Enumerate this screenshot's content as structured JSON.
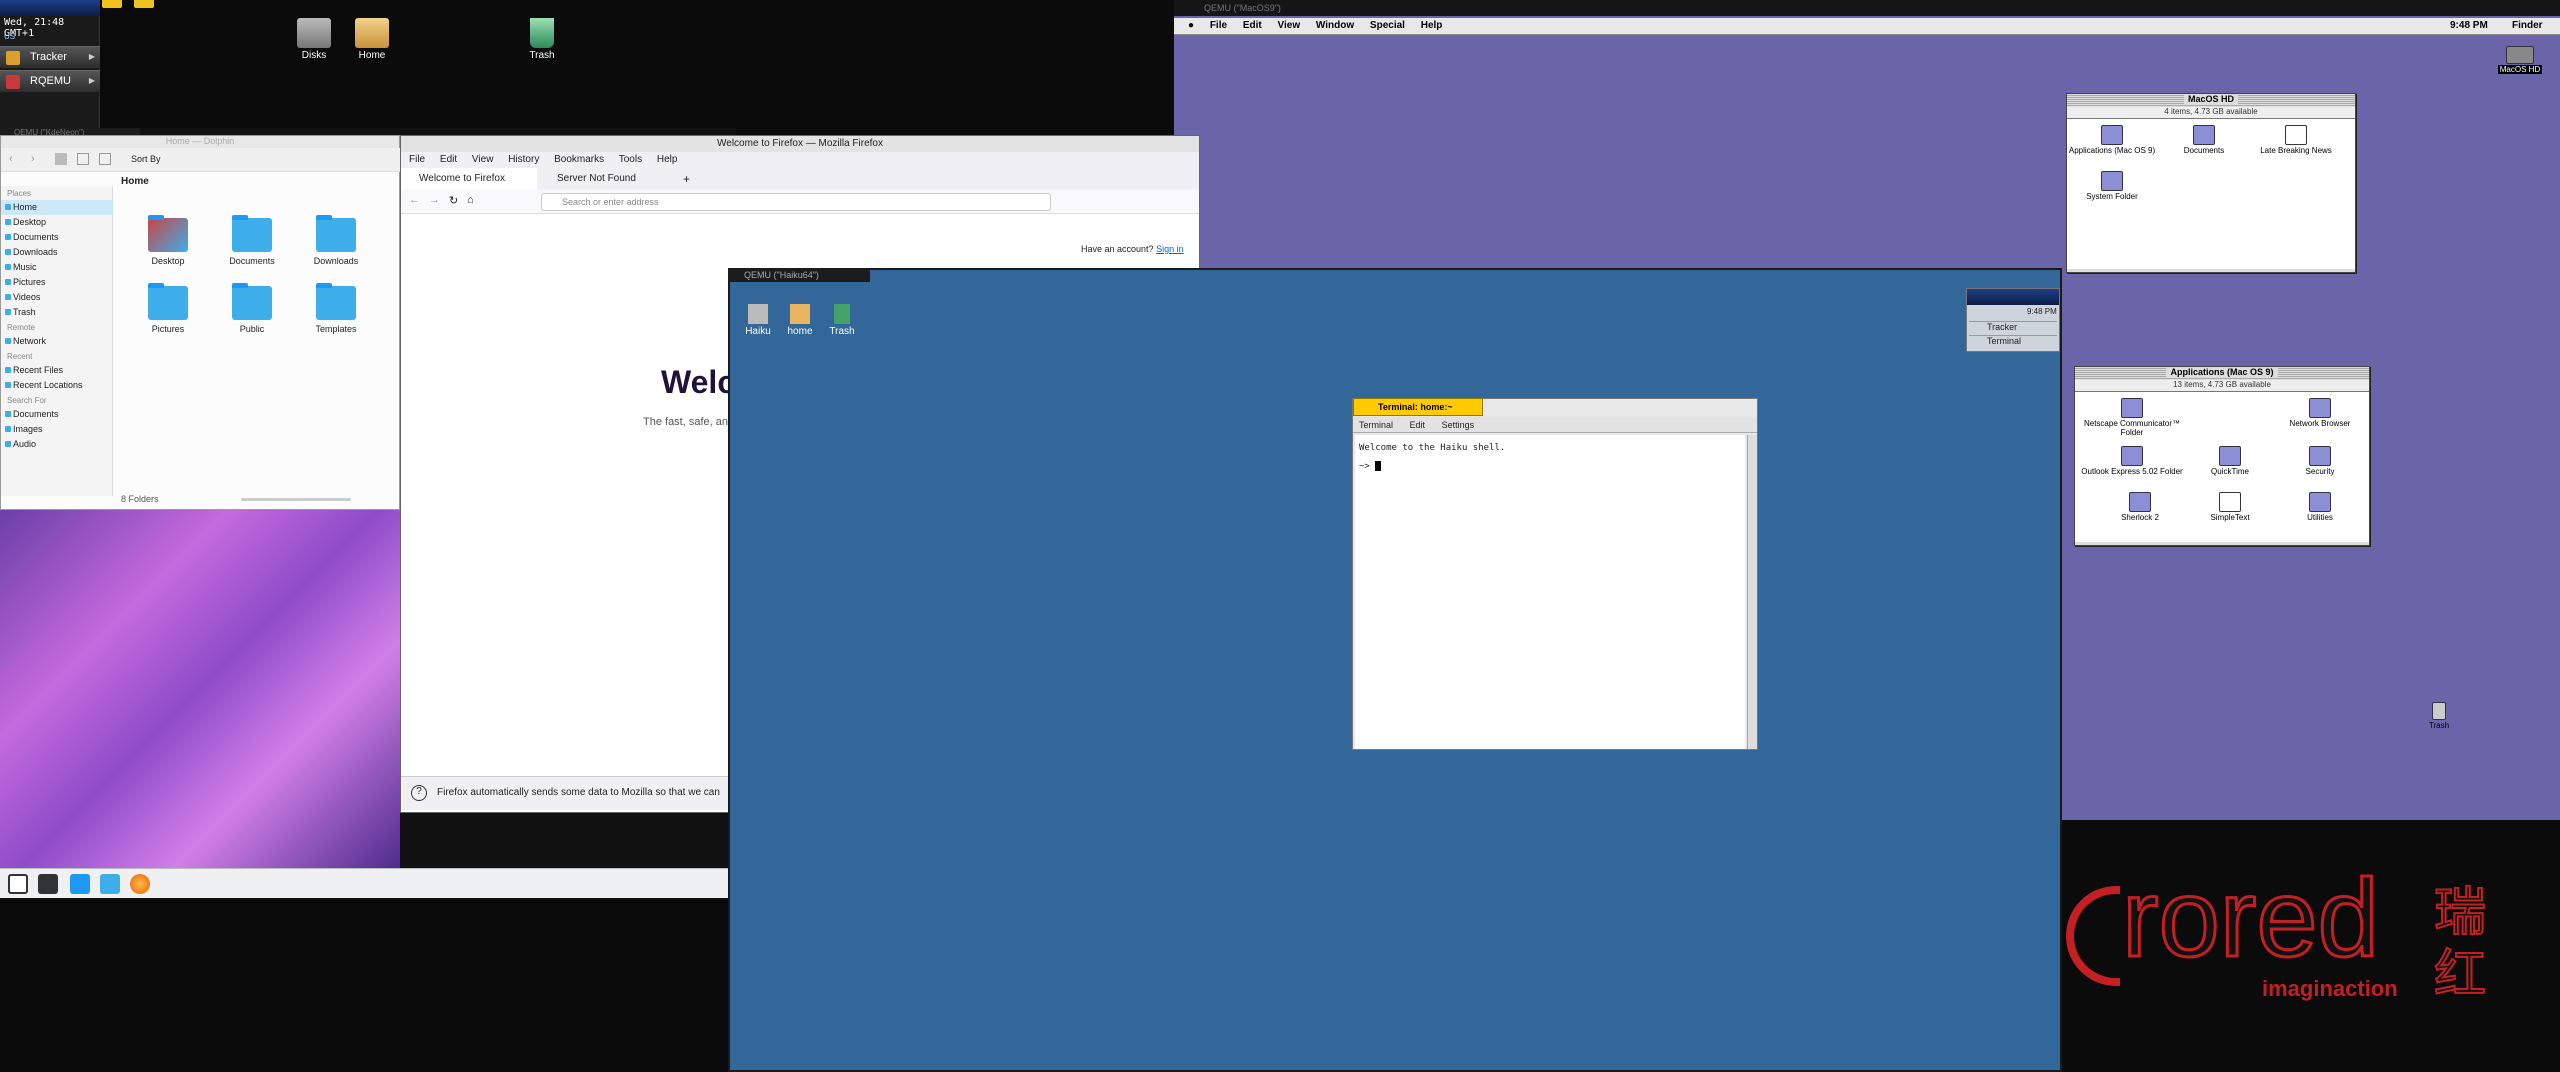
{
  "haiku_deskbar": {
    "clock": "Wed, 21:48 GMT+1",
    "tray": "US",
    "items": [
      {
        "label": "Tracker"
      },
      {
        "label": "RQEMU"
      }
    ]
  },
  "top_desktop_icons": [
    {
      "label": "Disks"
    },
    {
      "label": "Home"
    },
    {
      "label": "Trash"
    }
  ],
  "qemu_mac": {
    "title": "QEMU (\"MacOS9\")",
    "menubar": [
      "File",
      "Edit",
      "View",
      "Window",
      "Special",
      "Help"
    ],
    "time": "9:48 PM",
    "app": "Finder",
    "hd_icon": "MacOS HD",
    "trash_label": "Trash",
    "hd_window": {
      "title": "MacOS HD",
      "info": "4 items, 4.73 GB available",
      "items": [
        "Applications (Mac OS 9)",
        "Documents",
        "Late Breaking News",
        "System Folder"
      ]
    },
    "apps_window": {
      "title": "Applications (Mac OS 9)",
      "info": "13 items, 4.73 GB available",
      "items": [
        "Netscape Communicator™ Folder",
        "Network Browser",
        "Outlook Express 5.02 Folder",
        "QuickTime",
        "Security",
        "Sherlock 2",
        "SimpleText",
        "Utilities"
      ]
    }
  },
  "kde": {
    "qemu_title": "QEMU (\"KdeNeon\")",
    "dolphin": {
      "title": "Home — Dolphin",
      "sort_label": "Sort By",
      "breadcrumb": "Home",
      "places_header": "Places",
      "places": [
        "Home",
        "Desktop",
        "Documents",
        "Downloads",
        "Music",
        "Pictures",
        "Videos",
        "Trash"
      ],
      "remote_header": "Remote",
      "remote": [
        "Network"
      ],
      "recent_header": "Recent",
      "recent": [
        "Recent Files",
        "Recent Locations"
      ],
      "search_header": "Search For",
      "search": [
        "Documents",
        "Images",
        "Audio"
      ],
      "folders": [
        "Desktop",
        "Documents",
        "Downloads",
        "Pictures",
        "Public",
        "Templates"
      ],
      "status": "8 Folders"
    },
    "firefox": {
      "title": "Welcome to Firefox — Mozilla Firefox",
      "menu": [
        "File",
        "Edit",
        "View",
        "History",
        "Bookmarks",
        "Tools",
        "Help"
      ],
      "tab1": "Welcome to Firefox",
      "tab2": "Server Not Found",
      "url_placeholder": "Search or enter address",
      "account_q": "Have an account?",
      "signin": "Sign in",
      "heading": "Welc",
      "sub": "The fast, safe, and",
      "notice": "Firefox automatically sends some data to Mozilla so that we can"
    }
  },
  "qemu_haiku": {
    "title": "QEMU (\"Haiku64\")",
    "desktop_icons": [
      "Haiku",
      "home",
      "Trash"
    ],
    "deskbar_time": "9:48 PM",
    "deskbar_items": [
      "Tracker",
      "Terminal"
    ],
    "terminal": {
      "title": "Terminal: home:~",
      "menu": [
        "Terminal",
        "Edit",
        "Settings"
      ],
      "line1": "Welcome to the Haiku shell.",
      "prompt": "~>"
    }
  },
  "logo": {
    "word": "rored",
    "tagline": "imaginaction",
    "cjk": "瑞红"
  },
  "colors": {
    "haiku_blue": "#336699",
    "mac_purple": "#6a64a8",
    "kde_blue": "#3daee9",
    "haiku_yellow": "#ffcb00",
    "logo_red": "#c42024"
  }
}
